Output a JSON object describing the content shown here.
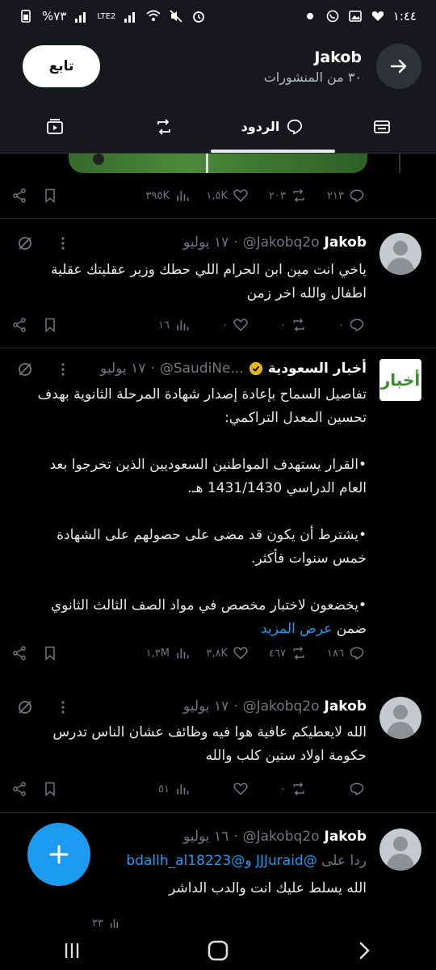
{
  "status_bar": {
    "time": "١:٤٤",
    "battery": "%٧٣",
    "network": "LTE2"
  },
  "header": {
    "title": "Jakob",
    "subtitle": "٣٠ من المنشورات",
    "follow_label": "تابع"
  },
  "tabs": [
    {
      "label": "",
      "icon": "media-icon"
    },
    {
      "label": "",
      "icon": "repost-icon"
    },
    {
      "label": "الردود",
      "icon": "reply-icon"
    },
    {
      "label": "",
      "icon": "highlights-icon"
    }
  ],
  "top_post_actions": {
    "replies": "٢١٣",
    "reposts": "٢٠٣",
    "likes": "١,٥K",
    "views": "٣٩٥K"
  },
  "posts": [
    {
      "name": "Jakob",
      "handle": "@Jakobq2o",
      "date": "١٧ يوليو",
      "lines": [
        "ياخي انت مين ابن الحرام اللي حطك وزير عقليتك عقلية",
        "اطفال والله اخر زمن"
      ],
      "replies": "٠",
      "reposts": "٠",
      "likes": "٠",
      "views": "١٦"
    },
    {
      "name": "أخبار السعودية",
      "handle": "@SaudiNe...",
      "date": "١٧ يوليو",
      "logo_text": "أخبار",
      "lines": [
        "تفاصيل السماح بإعادة إصدار شهادة المرحلة الثانوية بهدف",
        "تحسين المعدل التراكمي:",
        "",
        "•القرار يستهدف المواطنين السعوديين الذين تخرجوا بعد",
        "العام الدراسي 1431/1430 هـ.",
        "",
        "•يشترط أن يكون قد مضى على حصولهم على الشهادة",
        "خمس سنوات فأكثر.",
        "",
        "•يخضعون لاختبار مخصص في مواد الصف الثالث الثانوي"
      ],
      "last_line_prefix": "ضمن",
      "show_more": "عرض المزيد",
      "replies": "١٨٦",
      "reposts": "٤٦٧",
      "likes": "٣,٨K",
      "views": "١,٣M"
    },
    {
      "name": "Jakob",
      "handle": "@Jakobq2o",
      "date": "١٧ يوليو",
      "lines": [
        "الله لايعطيكم عافية هوا فيه وظائف عشان الناس تدرس",
        "حكومة اولاد ستين كلب والله"
      ],
      "replies": "",
      "reposts": "٠",
      "likes": "",
      "views": "٥١"
    },
    {
      "name": "Jakob",
      "handle": "@Jakobq2o",
      "date": "١٦ يوليو",
      "reply_to_prefix": "ردا على",
      "reply_to_users": "@JJJuraid و@bdallh_al18223",
      "lines": [
        "الله يسلط عليك انت والدب الداشر"
      ],
      "views": "٣٣"
    }
  ],
  "colors": {
    "accent": "#1d9bf0",
    "background": "#000000",
    "header": "#16181c",
    "muted": "#71767b"
  }
}
